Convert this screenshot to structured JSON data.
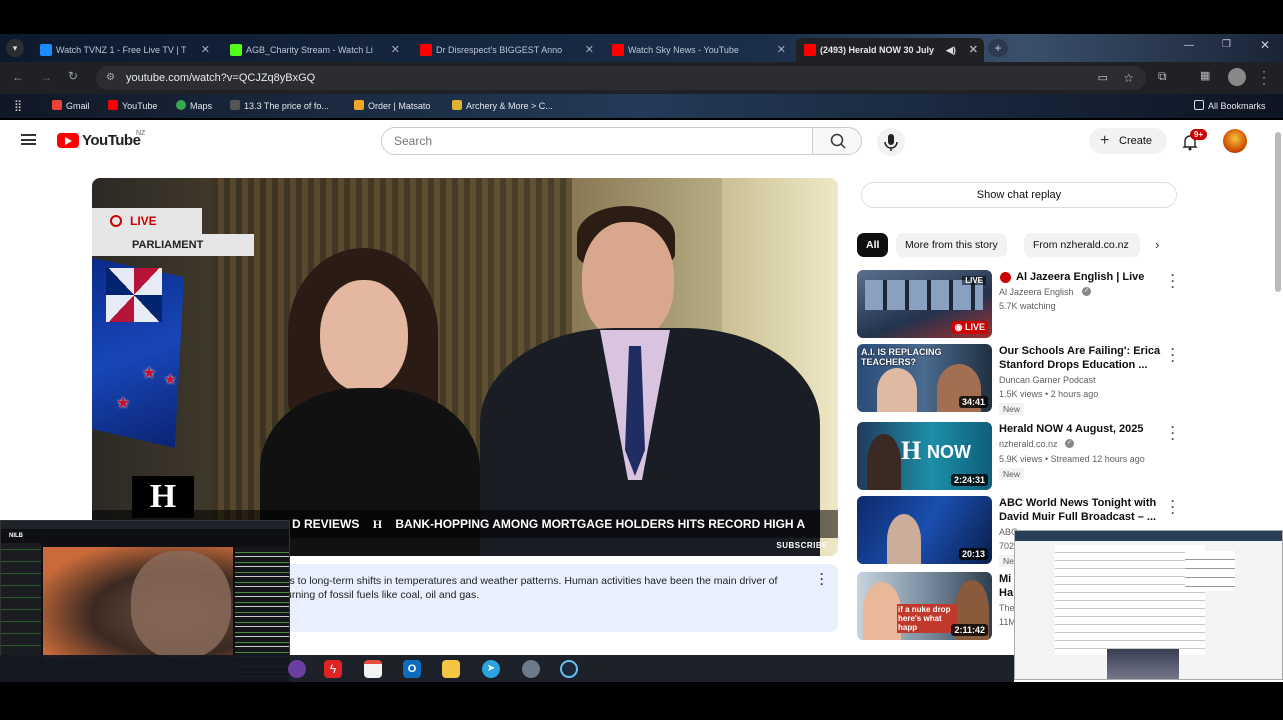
{
  "browser": {
    "tabs": [
      {
        "title": "Watch TVNZ 1 - Free Live TV | T",
        "favicon_color": "#1a8cff"
      },
      {
        "title": "AGB_Charity Stream - Watch Li",
        "favicon_color": "#53fc18"
      },
      {
        "title": "Dr Disrespect's BIGGEST Anno",
        "favicon_color": "#ff0000"
      },
      {
        "title": "Watch Sky News - YouTube",
        "favicon_color": "#ff0000"
      },
      {
        "title": "(2493) Herald NOW 30 July",
        "favicon_color": "#ff0000",
        "active": true
      }
    ],
    "url": "youtube.com/watch?v=QCJZq8yBxGQ",
    "bookmarks": [
      {
        "label": "Gmail",
        "color": "#ea4335"
      },
      {
        "label": "YouTube",
        "color": "#ff0000"
      },
      {
        "label": "Maps",
        "color": "#34a853"
      },
      {
        "label": "13.3 The price of fo...",
        "color": "#555555"
      },
      {
        "label": "Order | Matsato",
        "color": "#f5a623"
      },
      {
        "label": "Archery & More > C...",
        "color": "#e0b030"
      }
    ],
    "all_bookmarks": "All Bookmarks"
  },
  "youtube": {
    "logo_text": "YouTube",
    "region": "NZ",
    "search_placeholder": "Search",
    "create_label": "Create",
    "notification_count": "9+",
    "video": {
      "live_label": "LIVE",
      "section_label": "PARLIAMENT",
      "ticker_left": "D REVIEWS",
      "ticker_main": "BANK-HOPPING AMONG MORTGAGE HOLDERS HITS RECORD HIGH A",
      "logo_letter": "H",
      "subscribe_label": "SUBSCRIBE"
    },
    "info_panel": {
      "line1": "rs to long-term shifts in temperatures and weather patterns. Human activities have been the main driver of",
      "line2": "urning of fossil fuels like coal, oil and gas."
    },
    "chat_replay_label": "Show chat replay",
    "chips": [
      "All",
      "More from this story",
      "From nzherald.co.nz"
    ],
    "recommendations": [
      {
        "title": "Al Jazeera English | Live",
        "channel": "Al Jazeera English",
        "meta": "5.7K watching",
        "badge_live": "LIVE",
        "thumb_live": "LIVE",
        "verified": true
      },
      {
        "title": "Our Schools Are Failing': Erica Stanford Drops Education ...",
        "channel": "Duncan Garner Podcast",
        "meta": "1.5K views • 2 hours ago",
        "duration": "34:41",
        "new": "New",
        "thumb_text": "A.I. IS REPLACING TEACHERS?"
      },
      {
        "title": "Herald NOW 4 August, 2025",
        "channel": "nzherald.co.nz",
        "meta": "5.9K views • Streamed 12 hours ago",
        "duration": "2:24:31",
        "new": "New",
        "thumb_text": "NOW",
        "verified": true
      },
      {
        "title": "ABC World News Tonight with David Muir Full Broadcast – ...",
        "channel": "ABC",
        "meta": "702",
        "duration": "20:13",
        "new": "Ne"
      },
      {
        "title": "Mi Ha",
        "channel": "The",
        "meta": "11M",
        "duration": "2:11:42",
        "thumb_text": "if a nuke drop here's what happ"
      }
    ]
  },
  "overlay_stream": {
    "viewer_label": "NILB"
  },
  "colors": {
    "yt_red": "#ff0000",
    "chip_active_bg": "#0f0f0f",
    "info_bg": "#e8f0fe"
  }
}
